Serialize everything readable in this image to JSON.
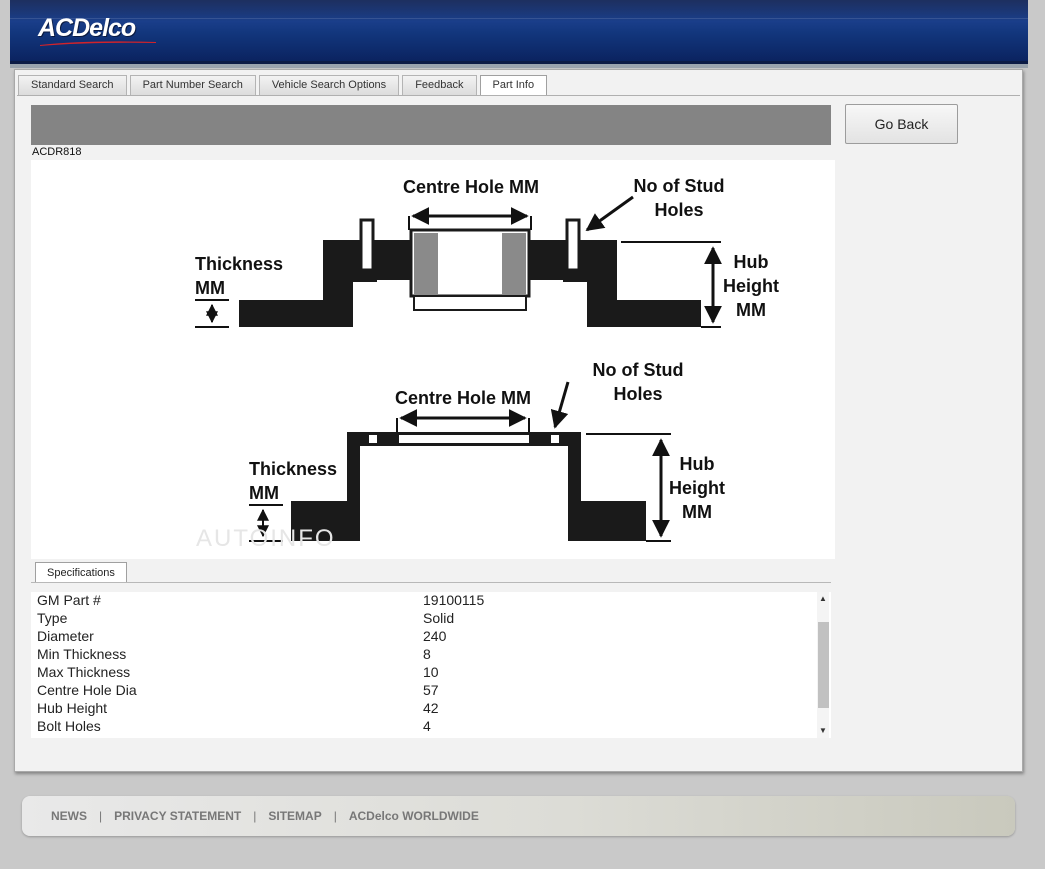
{
  "brand": {
    "logo_text": "ACDelco"
  },
  "tabs": [
    {
      "label": "Standard Search",
      "active": false
    },
    {
      "label": "Part Number Search",
      "active": false
    },
    {
      "label": "Vehicle Search Options",
      "active": false
    },
    {
      "label": "Feedback",
      "active": false
    },
    {
      "label": "Part Info",
      "active": true
    }
  ],
  "part": {
    "code": "ACDR818"
  },
  "go_back_label": "Go Back",
  "diagram": {
    "top": {
      "centre_hole": "Centre Hole MM",
      "stud_line1": "No of Stud",
      "stud_line2": "Holes",
      "thickness_line1": "Thickness",
      "thickness_line2": "MM",
      "hub_line1": "Hub",
      "hub_line2": "Height",
      "hub_line3": "MM"
    },
    "bottom": {
      "centre_hole": "Centre Hole MM",
      "stud_line1": "No of Stud",
      "stud_line2": "Holes",
      "thickness_line1": "Thickness",
      "thickness_line2": "MM",
      "hub_line1": "Hub",
      "hub_line2": "Height",
      "hub_line3": "MM"
    },
    "watermark": "AUTOINFO"
  },
  "specifications": {
    "tab_label": "Specifications",
    "rows": [
      {
        "key": "GM Part #",
        "value": "19100115"
      },
      {
        "key": "Type",
        "value": "Solid"
      },
      {
        "key": "Diameter",
        "value": "240"
      },
      {
        "key": "Min Thickness",
        "value": "8"
      },
      {
        "key": "Max Thickness",
        "value": "10"
      },
      {
        "key": "Centre Hole Dia",
        "value": "57"
      },
      {
        "key": "Hub Height",
        "value": "42"
      },
      {
        "key": "Bolt Holes",
        "value": "4"
      }
    ]
  },
  "footer": {
    "links": [
      "NEWS",
      "PRIVACY STATEMENT",
      "SITEMAP",
      "ACDelco WORLDWIDE"
    ],
    "separator": "|"
  },
  "colors": {
    "header_blue": "#12367c",
    "gray_bar": "#848484",
    "diagram_black": "#1a1a1a",
    "diagram_gray": "#8a8a8a"
  }
}
